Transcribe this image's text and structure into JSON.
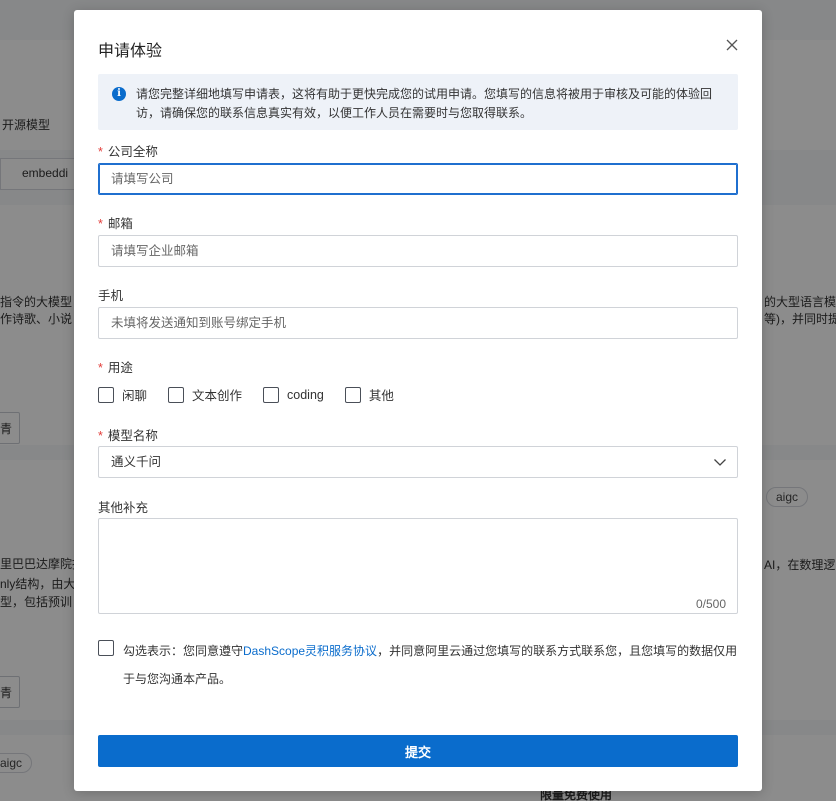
{
  "background": {
    "frag_open_source": "开源模型",
    "frag_embedding": "embeddi",
    "frag_instruction": "指令的大模型",
    "frag_poetry": "作诗歌、小说",
    "frag_right1": "的大型语言模",
    "frag_right2": "等)，并同时提",
    "frag_damo": "里巴巴达摩院推",
    "frag_only": "nly结构，由大",
    "frag_type": "型，包括预训",
    "frag_ai": "AI，在数理逻",
    "frag_free": "限量免费使用",
    "frag_btn1": "青",
    "frag_btn2": "青",
    "tag_aigc_1": "aigc",
    "tag_aigc_2": "aigc"
  },
  "modal": {
    "title": "申请体验",
    "notice": "请您完整详细地填写申请表，这将有助于更快完成您的试用申请。您填写的信息将被用于审核及可能的体验回访，请确保您的联系信息真实有效，以便工作人员在需要时与您取得联系。",
    "company": {
      "label": "公司全称",
      "placeholder": "请填写公司"
    },
    "email": {
      "label": "邮箱",
      "placeholder": "请填写企业邮箱"
    },
    "phone": {
      "label": "手机",
      "placeholder": "未填将发送通知到账号绑定手机"
    },
    "usage": {
      "label": "用途",
      "options": [
        "闲聊",
        "文本创作",
        "coding",
        "其他"
      ]
    },
    "model": {
      "label": "模型名称",
      "value": "通义千问"
    },
    "extra": {
      "label": "其他补充",
      "counter": "0/500"
    },
    "agreement": {
      "prefix": "勾选表示：您同意遵守",
      "link": "DashScope灵积服务协议",
      "suffix": "，并同意阿里云通过您填写的联系方式联系您，且您填写的数据仅用于与您沟通本产品。"
    },
    "submit_label": "提交",
    "required_mark": "*"
  }
}
